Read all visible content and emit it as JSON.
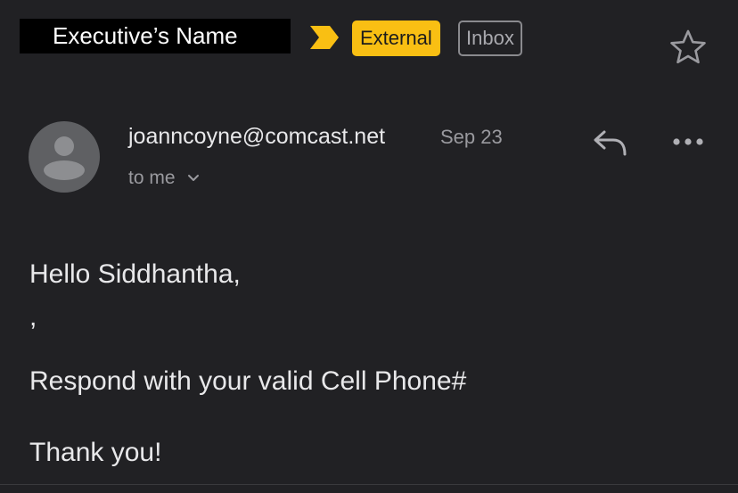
{
  "header": {
    "subject": "Executive’s Name",
    "importance_icon": "importance-marker-icon",
    "labels": {
      "external": "External",
      "inbox": "Inbox"
    },
    "star_icon": "star-outline-icon"
  },
  "message": {
    "avatar_icon": "person-silhouette-icon",
    "sender": "joanncoyne@comcast.net",
    "date": "Sep 23",
    "recipient": "to me",
    "reply_icon": "reply-icon",
    "more_icon": "more-horizontal-icon",
    "body": {
      "greeting": "Hello Siddhantha,",
      "stray_char": ",",
      "request": "Respond with your valid Cell Phone#",
      "closing": "Thank you!"
    }
  },
  "colors": {
    "background": "#212124",
    "external_label": "#f9bf13",
    "inbox_border": "#8a8a8e",
    "secondary_text": "#9a9a9f",
    "primary_text": "#e8e8ea"
  }
}
